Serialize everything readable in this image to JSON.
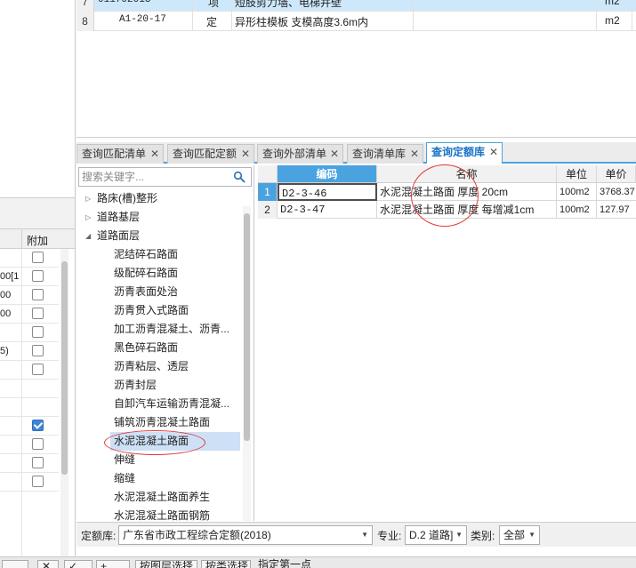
{
  "top_grid": {
    "rows": [
      {
        "num": "7",
        "code": "011702013",
        "type": "项",
        "name": "短肢剪力墙、电梯井壁",
        "unit": "m2"
      },
      {
        "num": "8",
        "code": "A1-20-17",
        "type": "定",
        "name": "异形柱模板 支模高度3.6m内",
        "unit": "m2"
      }
    ]
  },
  "left_panel": {
    "header_label": "附加",
    "rows": [
      {
        "text": "",
        "checked": false
      },
      {
        "text": "00[1",
        "checked": false
      },
      {
        "text": "00",
        "checked": false
      },
      {
        "text": "00",
        "checked": false
      },
      {
        "text": "",
        "checked": false
      },
      {
        "text": "5)",
        "checked": false
      },
      {
        "text": "",
        "checked": false
      },
      {
        "text": "",
        "checked": null
      },
      {
        "text": "",
        "checked": null
      },
      {
        "text": "",
        "checked": true
      },
      {
        "text": "",
        "checked": false
      },
      {
        "text": "",
        "checked": false
      },
      {
        "text": "",
        "checked": false
      }
    ]
  },
  "tabs": [
    {
      "label": "查询匹配清单",
      "close": "✕"
    },
    {
      "label": "查询匹配定额",
      "close": "✕"
    },
    {
      "label": "查询外部清单",
      "close": "✕"
    },
    {
      "label": "查询清单库",
      "close": "✕"
    },
    {
      "label": "查询定额库",
      "close": "✕",
      "active": true
    }
  ],
  "search": {
    "placeholder": "搜索关键字..."
  },
  "tree": [
    {
      "label": "路床(槽)整形",
      "level": 0,
      "arrow": "▷"
    },
    {
      "label": "道路基层",
      "level": 0,
      "arrow": "▷"
    },
    {
      "label": "道路面层",
      "level": 0,
      "arrow": "◢"
    },
    {
      "label": "泥结碎石路面",
      "level": 1
    },
    {
      "label": "级配碎石路面",
      "level": 1
    },
    {
      "label": "沥青表面处治",
      "level": 1
    },
    {
      "label": "沥青贯入式路面",
      "level": 1
    },
    {
      "label": "加工沥青混凝土、沥青...",
      "level": 1
    },
    {
      "label": "黑色碎石路面",
      "level": 1
    },
    {
      "label": "沥青粘层、透层",
      "level": 1
    },
    {
      "label": "沥青封层",
      "level": 1
    },
    {
      "label": "自卸汽车运输沥青混凝...",
      "level": 1
    },
    {
      "label": "铺筑沥青混凝土路面",
      "level": 1
    },
    {
      "label": "水泥混凝土路面",
      "level": 1,
      "selected": true
    },
    {
      "label": "伸缝",
      "level": 1
    },
    {
      "label": "缩缝",
      "level": 1
    },
    {
      "label": "水泥混凝土路面养生",
      "level": 1
    },
    {
      "label": "水泥混凝土路面钢筋",
      "level": 1
    }
  ],
  "results": {
    "columns": {
      "code": "编码",
      "name": "名称",
      "unit": "单位",
      "price": "单价"
    },
    "rows": [
      {
        "num": "1",
        "code": "D2-3-46",
        "name": "水泥混凝土路面 厚度 20cm",
        "unit": "100m2",
        "price": "3768.37"
      },
      {
        "num": "2",
        "code": "D2-3-47",
        "name": "水泥混凝土路面 厚度 每增减1cm",
        "unit": "100m2",
        "price": "127.97"
      }
    ]
  },
  "filter": {
    "library_label": "定额库:",
    "library_value": "广东省市政工程综合定额(2018)",
    "major_label": "专业:",
    "major_value": "D.2 道路]",
    "category_label": "类别:",
    "category_value": "全部",
    "dropdown_arrow": "▼"
  },
  "bottom_bar": {
    "buttons": [
      "",
      "✕",
      "✓",
      "+",
      "按图层选择",
      "按类选择"
    ],
    "status_text": "指定第一点"
  },
  "colors": {
    "accent": "#4aa3df",
    "selection": "#cde8fb",
    "annotation": "#e03c3c"
  }
}
